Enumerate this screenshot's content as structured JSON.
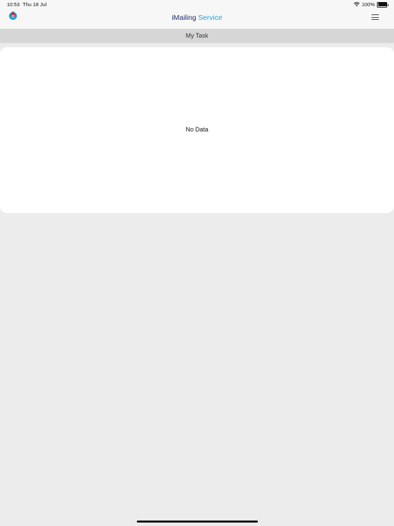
{
  "status_bar": {
    "time": "10:53",
    "date": "Thu 18 Jul",
    "battery": "100%",
    "wifi_icon": "wifi-icon",
    "battery_icon": "battery-icon"
  },
  "header": {
    "logo_icon": "app-logo-icon",
    "title_part1": "iMailing",
    "title_part2": "Service",
    "menu_icon": "hamburger-menu-icon"
  },
  "subheader": {
    "title": "My Task"
  },
  "task_list": {
    "empty_text": "No Data"
  },
  "colors": {
    "title_dark": "#1e2a6b",
    "title_accent": "#1aa3d9",
    "background": "#ececec",
    "subheader_bg": "#d6d6d6"
  }
}
